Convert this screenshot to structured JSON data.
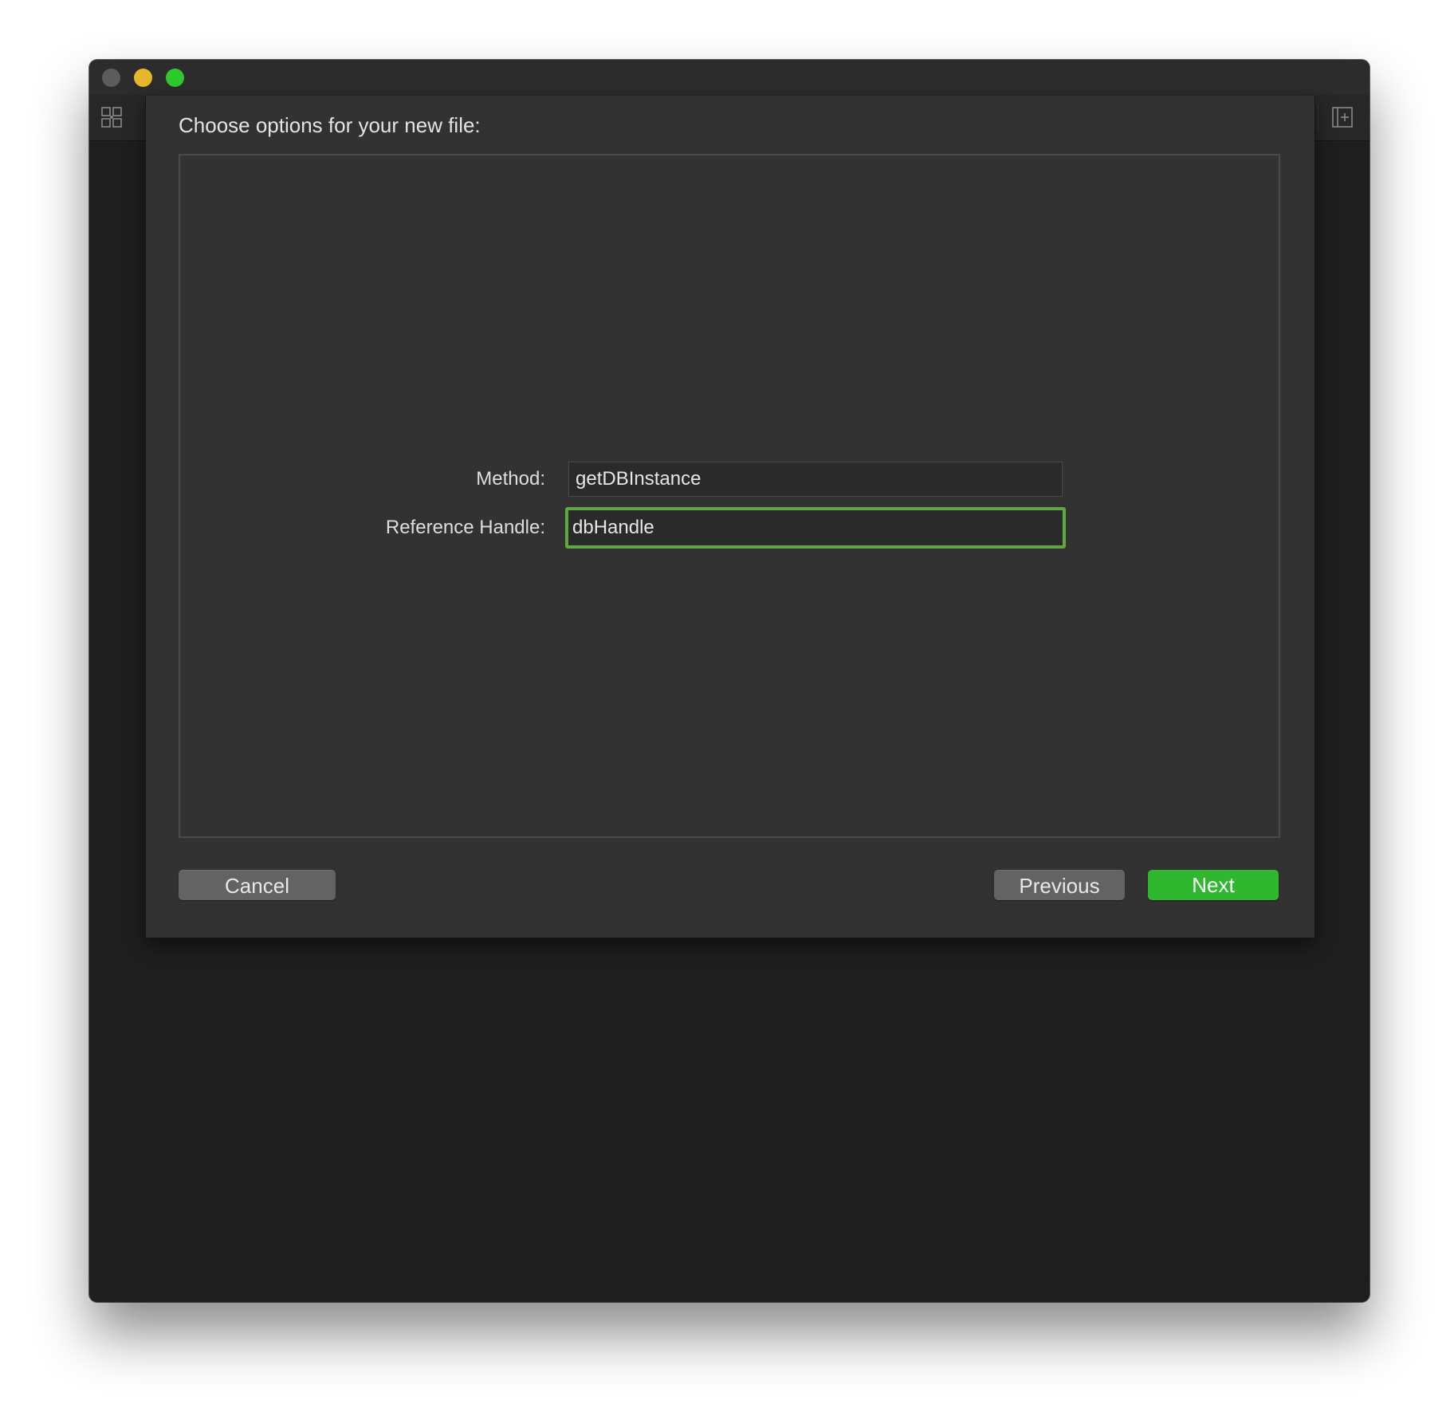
{
  "window": {
    "traffic_lights": {
      "close_color": "#5c5c5c",
      "minimize_color": "#e6b72c",
      "zoom_color": "#2fc82f"
    },
    "toolbar": {
      "left_icon": "library-grid-icon",
      "right_icon": "add-panel-icon"
    }
  },
  "sheet": {
    "title": "Choose options for your new file:",
    "fields": [
      {
        "label": "Method:",
        "value": "getDBInstance",
        "focused": false
      },
      {
        "label": "Reference Handle:",
        "value": "dbHandle",
        "focused": true
      }
    ],
    "buttons": {
      "cancel": "Cancel",
      "previous": "Previous",
      "next": "Next"
    },
    "accent_color": "#2fb82f",
    "focus_ring_color": "#5fa83c"
  }
}
